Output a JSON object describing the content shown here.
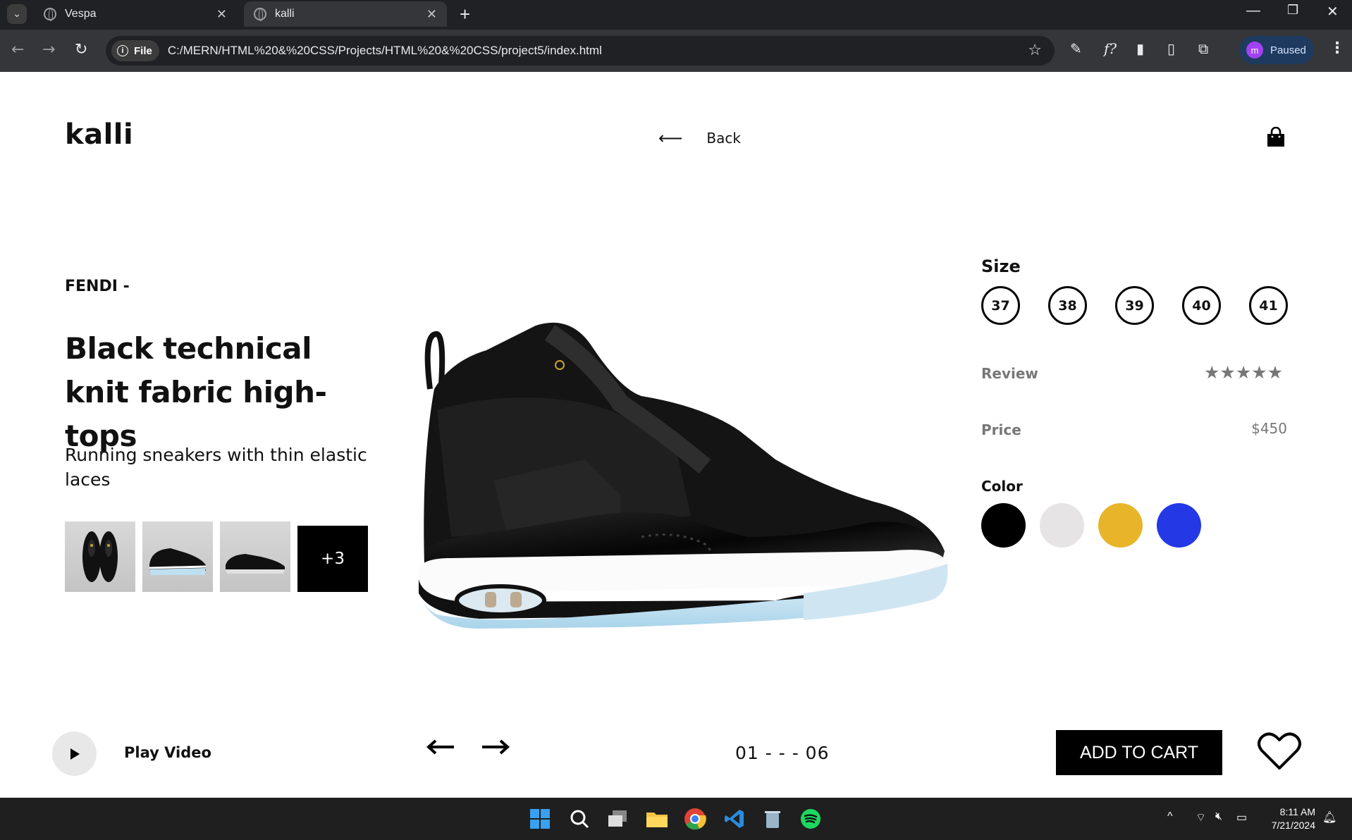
{
  "browser": {
    "tabs": [
      {
        "title": "Vespa"
      },
      {
        "title": "kalli"
      }
    ],
    "address": {
      "chip": "File",
      "url": "C:/MERN/HTML%20&%20CSS/Projects/HTML%20&%20CSS/project5/index.html"
    },
    "profile": {
      "initial": "m",
      "status": "Paused"
    }
  },
  "site": {
    "logo": "kalli",
    "back_label": "Back"
  },
  "product": {
    "brand": "FENDI -",
    "title": "Black technical knit fabric high-tops",
    "description": "Running sneakers with thin elastic laces",
    "more_thumbs": "+3",
    "size_label": "Size",
    "sizes": [
      "37",
      "38",
      "39",
      "40",
      "41"
    ],
    "review_label": "Review",
    "rating_stars": 5,
    "price_label": "Price",
    "price": "$450",
    "color_label": "Color",
    "colors": [
      "#000000",
      "#e6e4e4",
      "#e8b52a",
      "#2438e6"
    ]
  },
  "footer": {
    "play_label": "Play Video",
    "pager": "01 - - - 06",
    "add_to_cart": "ADD TO CART"
  },
  "taskbar": {
    "time": "8:11 AM",
    "date": "7/21/2024"
  }
}
